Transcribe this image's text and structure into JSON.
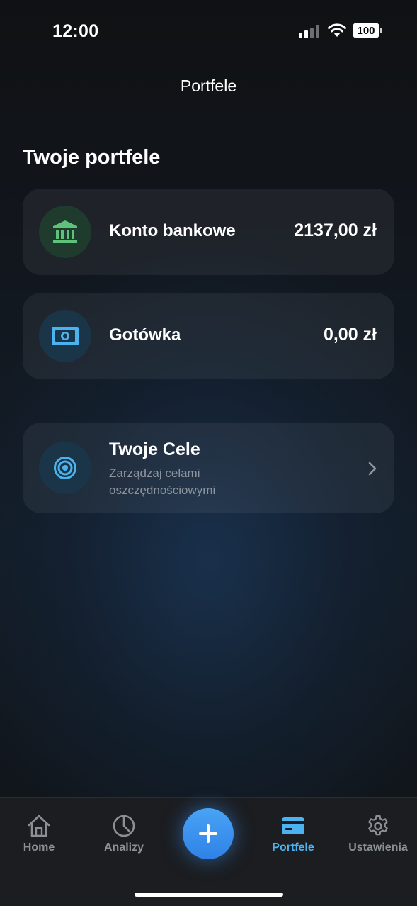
{
  "status_bar": {
    "time": "12:00",
    "battery": "100"
  },
  "header": {
    "title": "Portfele"
  },
  "section": {
    "title": "Twoje portfele"
  },
  "wallets": [
    {
      "label": "Konto bankowe",
      "amount": "2137,00 zł",
      "icon": "bank-icon",
      "accent": "#5fc27a"
    },
    {
      "label": "Gotówka",
      "amount": "0,00 zł",
      "icon": "cash-icon",
      "accent": "#4db3f0"
    }
  ],
  "goals": {
    "title": "Twoje Cele",
    "subtitle": "Zarządzaj celami oszczędnościowymi",
    "icon": "target-icon"
  },
  "tab_bar": {
    "tabs": [
      {
        "label": "Home",
        "icon": "home-icon",
        "active": false
      },
      {
        "label": "Analizy",
        "icon": "pie-chart-icon",
        "active": false
      },
      {
        "label": "Portfele",
        "icon": "wallet-card-icon",
        "active": true
      },
      {
        "label": "Ustawienia",
        "icon": "gear-icon",
        "active": false
      }
    ],
    "add_icon": "plus-icon"
  },
  "colors": {
    "accent": "#4db3f0",
    "add_button": "#3a8ff0",
    "bank_green": "#5fc27a"
  }
}
